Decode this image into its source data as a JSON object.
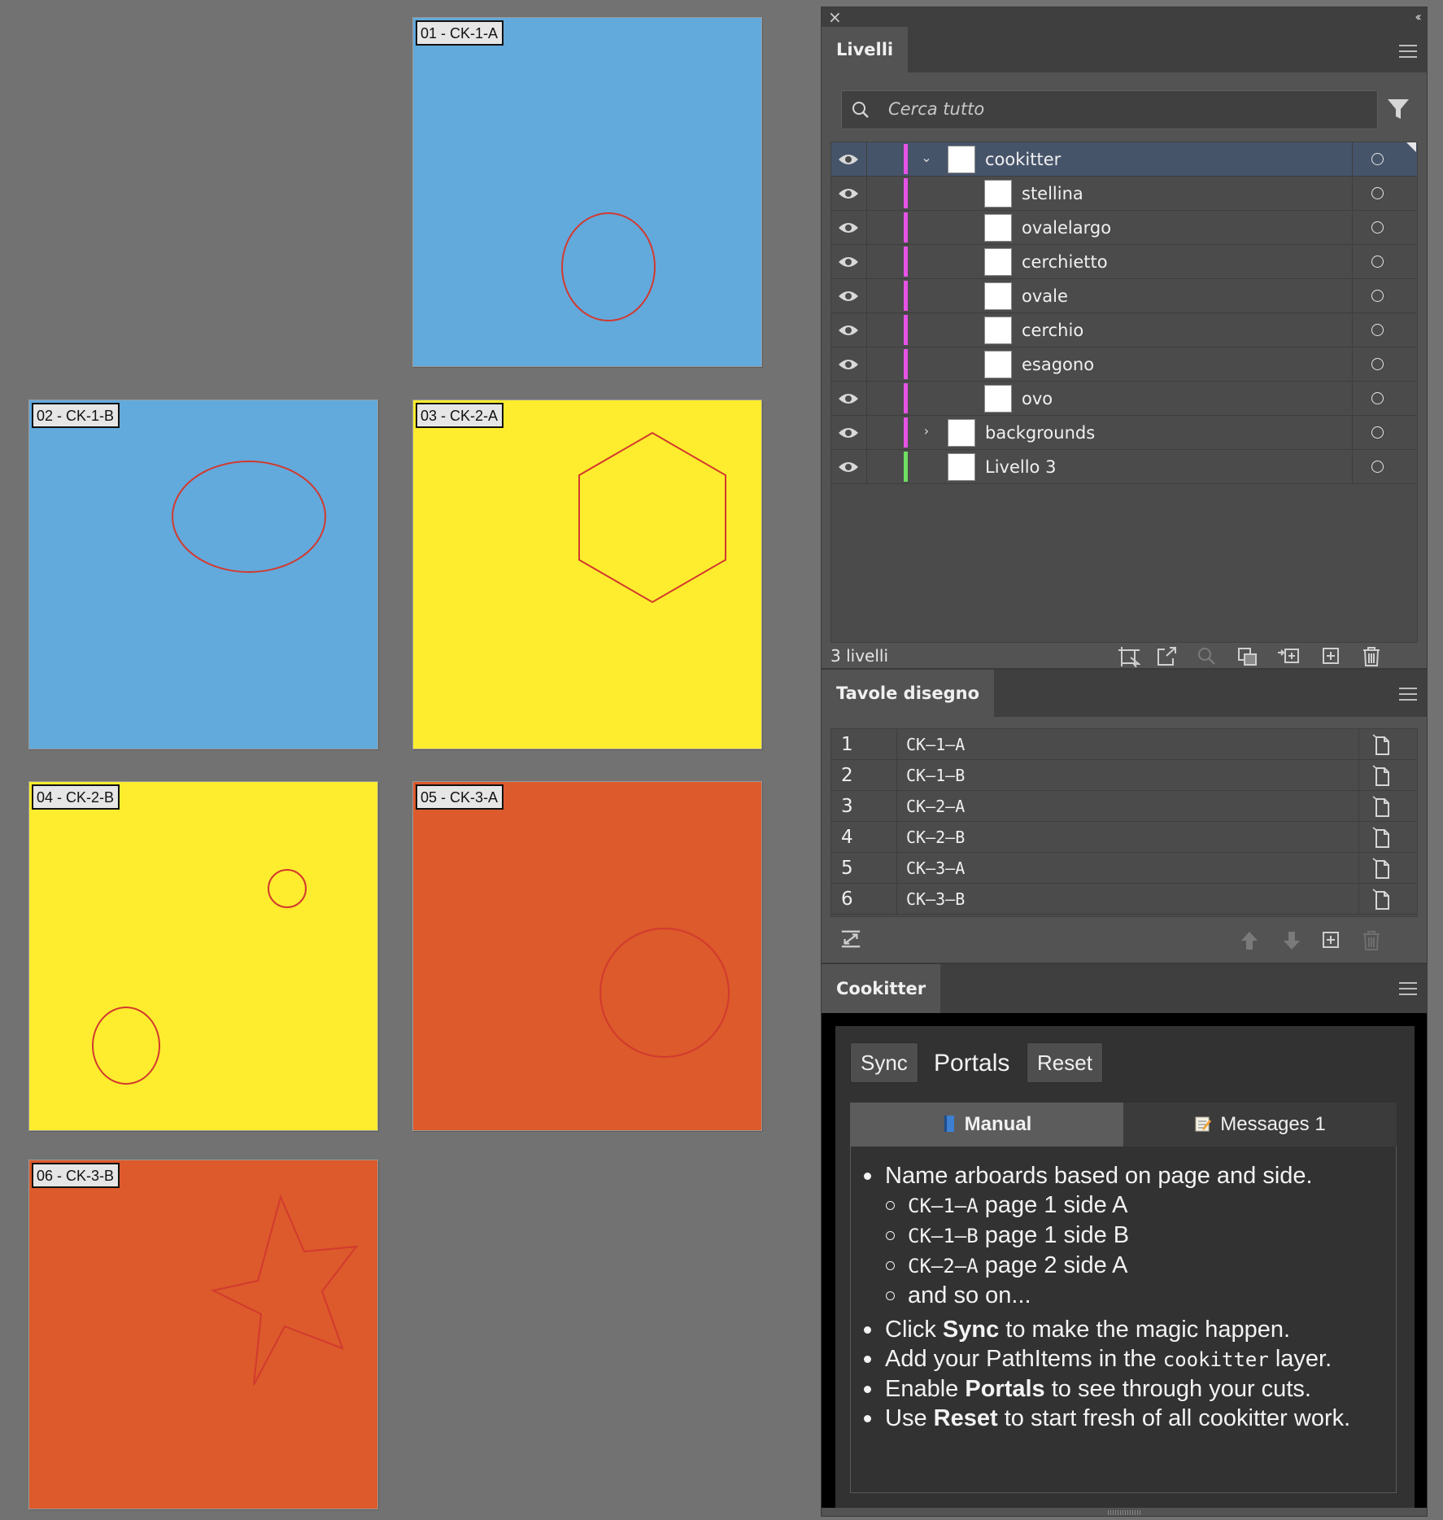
{
  "colors": {
    "blue": "#62a9dc",
    "yellow": "#feec2e",
    "orange": "#dc5a2b",
    "shape_stroke": "#d23a2e",
    "magenta": "#e653e6",
    "green": "#6fe060"
  },
  "artboards": [
    {
      "tag": "01 - CK-1-A",
      "color": "blue"
    },
    {
      "tag": "02 - CK-1-B",
      "color": "blue"
    },
    {
      "tag": "03 - CK-2-A",
      "color": "yellow"
    },
    {
      "tag": "04 - CK-2-B",
      "color": "yellow"
    },
    {
      "tag": "05 - CK-3-A",
      "color": "orange"
    },
    {
      "tag": "06 - CK-3-B",
      "color": "orange"
    }
  ],
  "layers_panel": {
    "close": "×",
    "collapse": "‹‹",
    "tab": "Livelli",
    "search_placeholder": "Cerca tutto",
    "layers": [
      {
        "name": "cookitter",
        "level": 0,
        "expanded": true,
        "color": "magenta",
        "selected": true
      },
      {
        "name": "stellina",
        "level": 1,
        "color": "magenta"
      },
      {
        "name": "ovalelargo",
        "level": 1,
        "color": "magenta"
      },
      {
        "name": "cerchietto",
        "level": 1,
        "color": "magenta"
      },
      {
        "name": "ovale",
        "level": 1,
        "color": "magenta"
      },
      {
        "name": "cerchio",
        "level": 1,
        "color": "magenta"
      },
      {
        "name": "esagono",
        "level": 1,
        "color": "magenta"
      },
      {
        "name": "ovo",
        "level": 1,
        "color": "magenta"
      },
      {
        "name": "backgrounds",
        "level": 0,
        "expanded": false,
        "color": "magenta"
      },
      {
        "name": "Livello 3",
        "level": 0,
        "color": "green"
      }
    ],
    "footer_count": "3 livelli",
    "footer_icons": [
      "collect-artboard-icon",
      "export-icon",
      "locate-object-icon",
      "clipping-mask-icon",
      "new-sublayer-icon",
      "new-layer-icon",
      "trash-icon"
    ]
  },
  "artboards_panel": {
    "tab": "Tavole disegno",
    "rows": [
      {
        "num": "1",
        "name": "CK–1–A"
      },
      {
        "num": "2",
        "name": "CK–1–B"
      },
      {
        "num": "3",
        "name": "CK–2–A"
      },
      {
        "num": "4",
        "name": "CK–2–B"
      },
      {
        "num": "5",
        "name": "CK–3–A"
      },
      {
        "num": "6",
        "name": "CK–3–B"
      }
    ],
    "footer_icons": [
      "rearrange-icon",
      "move-up-icon",
      "move-down-icon",
      "new-artboard-icon",
      "trash-icon"
    ]
  },
  "cookitter_panel": {
    "tab": "Cookitter",
    "sync": "Sync",
    "portals": "Portals",
    "portals_checked": false,
    "reset": "Reset",
    "tab_manual": "Manual",
    "tab_messages": "Messages 1",
    "manual": {
      "l1": "Name arboards based on page and side.",
      "s1_code": "CK–1–A",
      "s1_text": " page 1 side A",
      "s2_code": "CK–1–B",
      "s2_text": " page 1 side B",
      "s3_code": "CK–2–A",
      "s3_text": " page 2 side A",
      "s4": "and so on...",
      "l2a": "Click ",
      "l2b": "Sync",
      "l2c": " to make the magic happen.",
      "l3a": "Add your PathItems in the ",
      "l3b": "cookitter",
      "l3c": " layer.",
      "l4a": "Enable ",
      "l4b": "Portals",
      "l4c": " to see through your cuts.",
      "l5a": "Use ",
      "l5b": "Reset",
      "l5c": " to start fresh of all cookitter work."
    }
  }
}
